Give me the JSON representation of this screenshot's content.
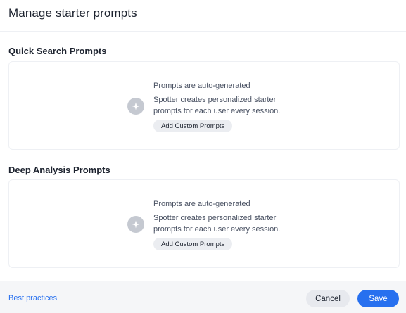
{
  "dialog": {
    "title": "Manage starter prompts"
  },
  "sections": [
    {
      "title": "Quick Search Prompts",
      "heading": "Prompts are auto-generated",
      "description": "Spotter creates personalized starter prompts for each user every session.",
      "button_label": "Add Custom Prompts",
      "icon": "sparkle-icon"
    },
    {
      "title": "Deep Analysis Prompts",
      "heading": "Prompts are auto-generated",
      "description": "Spotter creates personalized starter prompts for each user every session.",
      "button_label": "Add Custom Prompts",
      "icon": "sparkle-icon"
    }
  ],
  "footer": {
    "link_label": "Best practices",
    "cancel_label": "Cancel",
    "save_label": "Save"
  },
  "colors": {
    "accent": "#2770ef",
    "icon_bg": "#c5c9d1",
    "footer_bg": "#f5f6f8"
  }
}
